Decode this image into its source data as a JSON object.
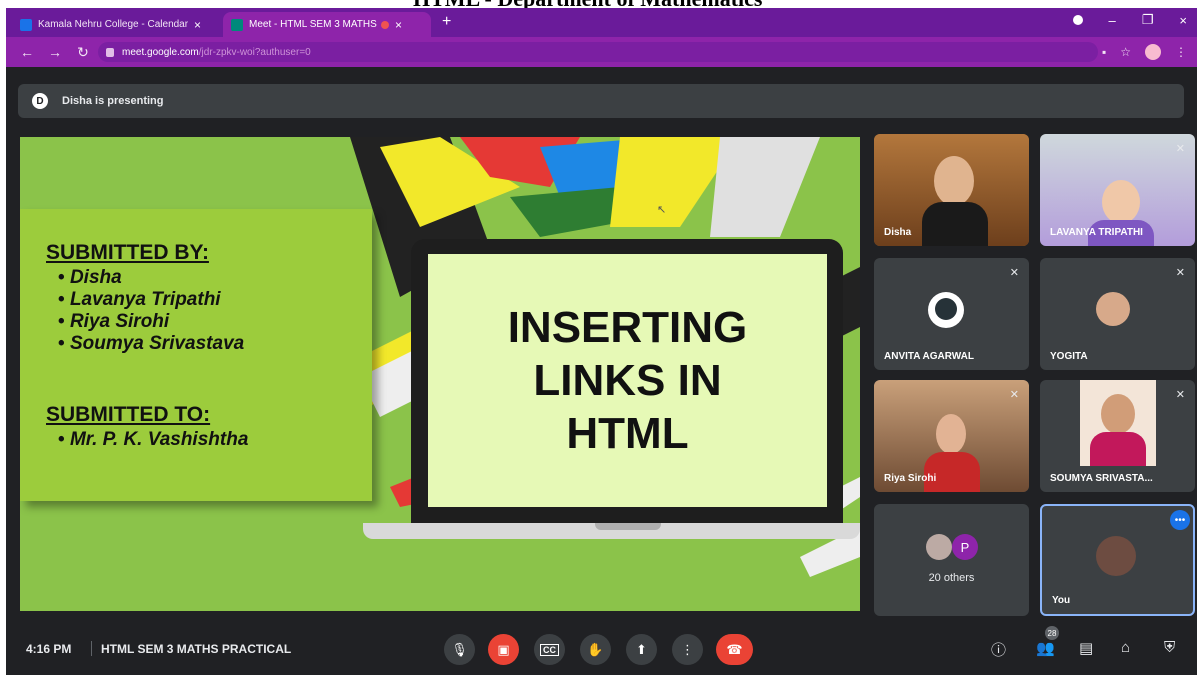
{
  "page_banner": "HTML - Department of Mathematics",
  "browser": {
    "tabs": [
      {
        "title": "Kamala Nehru College - Calendar",
        "close": "×"
      },
      {
        "title": "Meet - HTML SEM 3 MATHS",
        "close": "×"
      }
    ],
    "new_tab": "+",
    "window_controls": {
      "minimize": "–",
      "restore": "❐",
      "close": "×"
    },
    "url_host": "meet.google.com",
    "url_path": "/jdr-zpkv-woi?authuser=0"
  },
  "presenting": {
    "avatar_letter": "D",
    "text": "Disha is presenting"
  },
  "slide": {
    "submitted_by_heading": "SUBMITTED BY:",
    "submitted_by": [
      "Disha",
      "Lavanya Tripathi",
      "Riya Sirohi",
      "Soumya Srivastava"
    ],
    "submitted_to_heading": "SUBMITTED TO:",
    "submitted_to": [
      "Mr. P. K. Vashishtha"
    ],
    "title": "INSERTING\nLINKS IN\nHTML"
  },
  "participants": [
    {
      "name": "Disha",
      "muted": false
    },
    {
      "name": "LAVANYA TRIPATHI",
      "muted": true
    },
    {
      "name": "ANVITA AGARWAL",
      "muted": true
    },
    {
      "name": "YOGITA",
      "muted": true
    },
    {
      "name": "Riya Sirohi",
      "muted": true
    },
    {
      "name": "SOUMYA SRIVASTA...",
      "muted": true
    },
    {
      "name": "20 others",
      "avatar_letter": "P"
    },
    {
      "name": "You"
    }
  ],
  "bottom_bar": {
    "time": "4:16 PM",
    "meeting_name": "HTML SEM 3 MATHS PRACTICAL",
    "people_count": "28"
  },
  "colors": {
    "tab_strip": "#6a1b9a",
    "toolbar": "#8e24aa",
    "meet_bg": "#202124",
    "tile_bg": "#3c4043",
    "slide_green": "#8bc34a",
    "danger_red": "#ea4335",
    "you_tile_border": "#8ab4f8"
  },
  "icons": {
    "mic": "microphone-icon",
    "camera_off": "camera-off-icon",
    "captions": "captions-icon",
    "hand": "raise-hand-icon",
    "present": "present-screen-icon",
    "more": "more-options-icon",
    "leave": "leave-call-icon",
    "info": "info-icon",
    "people": "people-icon",
    "chat": "chat-icon",
    "activities": "activities-icon",
    "host_controls": "host-controls-icon"
  }
}
